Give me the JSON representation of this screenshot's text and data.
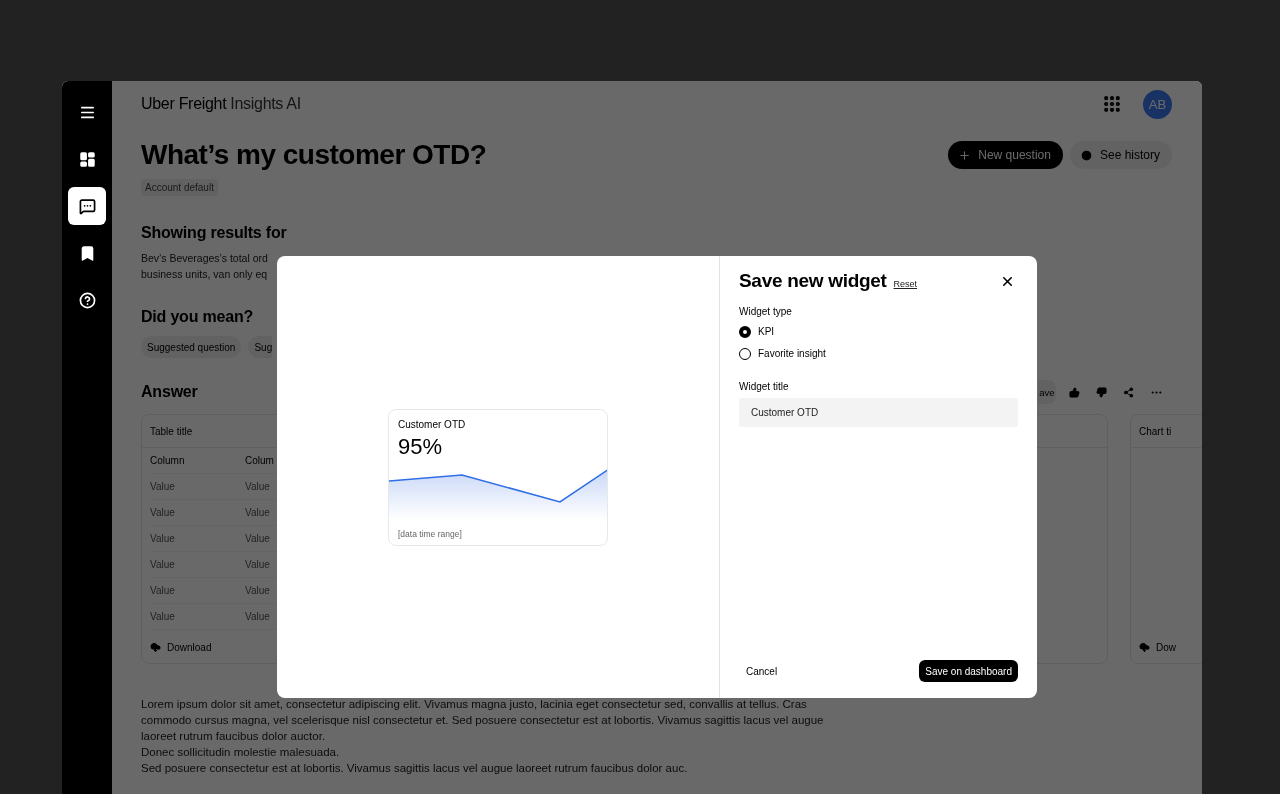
{
  "app": {
    "brand": "Uber Freight",
    "product": "Insights AI",
    "avatar": "AB"
  },
  "sidebar": {
    "items": [
      {
        "kind": "menu",
        "selected": false
      },
      {
        "kind": "dashboard",
        "selected": false
      },
      {
        "kind": "chat",
        "selected": true
      },
      {
        "kind": "bookmark",
        "selected": false
      },
      {
        "kind": "help",
        "selected": false
      }
    ]
  },
  "page": {
    "title": "What’s my customer OTD?",
    "tag": "Account default",
    "actions": [
      {
        "kind": "primary",
        "label": "New question"
      },
      {
        "kind": "secondary",
        "label": "See history"
      }
    ]
  },
  "results": {
    "heading": "Showing results for",
    "lines": [
      "Bev’s Beverages’s total ord",
      "business units, van only eq"
    ]
  },
  "suggestions": {
    "heading": "Did you mean?",
    "chips": [
      "Suggested question",
      "Sug"
    ]
  },
  "answer": {
    "heading": "Answer",
    "save_label": "ave",
    "table": {
      "title": "Table title",
      "columns": [
        "Column",
        "Colum"
      ],
      "rows": [
        [
          "Value",
          "Value"
        ],
        [
          "Value",
          "Value"
        ],
        [
          "Value",
          "Value"
        ],
        [
          "Value",
          "Value"
        ],
        [
          "Value",
          "Value"
        ],
        [
          "Value",
          "Value"
        ]
      ],
      "download": "Download"
    },
    "chart_card": {
      "title": "Chart ti",
      "download": "Dow"
    }
  },
  "body_text": [
    "Lorem ipsum dolor sit amet, consectetur adipiscing elit. Vivamus magna justo, lacinia eget consectetur sed, convallis at tellus. Cras commodo cursus magna, vel scelerisque nisl consectetur et. Sed posuere consectetur est at lobortis. Vivamus sagittis lacus vel augue laoreet rutrum faucibus dolor auctor.",
    "Donec sollicitudin molestie malesuada.",
    "Sed posuere consectetur est at lobortis. Vivamus sagittis lacus vel augue laoreet rutrum faucibus dolor auc."
  ],
  "modal": {
    "preview": {
      "title": "Customer OTD",
      "value": "95%",
      "range": "[data time range]"
    },
    "title": "Save new widget",
    "reset": "Reset",
    "type_label": "Widget type",
    "types": [
      {
        "label": "KPI",
        "selected": true
      },
      {
        "label": "Favorite insight",
        "selected": false
      }
    ],
    "title_label": "Widget title",
    "title_value": "Customer OTD",
    "cancel": "Cancel",
    "save": "Save on dashboard"
  }
}
